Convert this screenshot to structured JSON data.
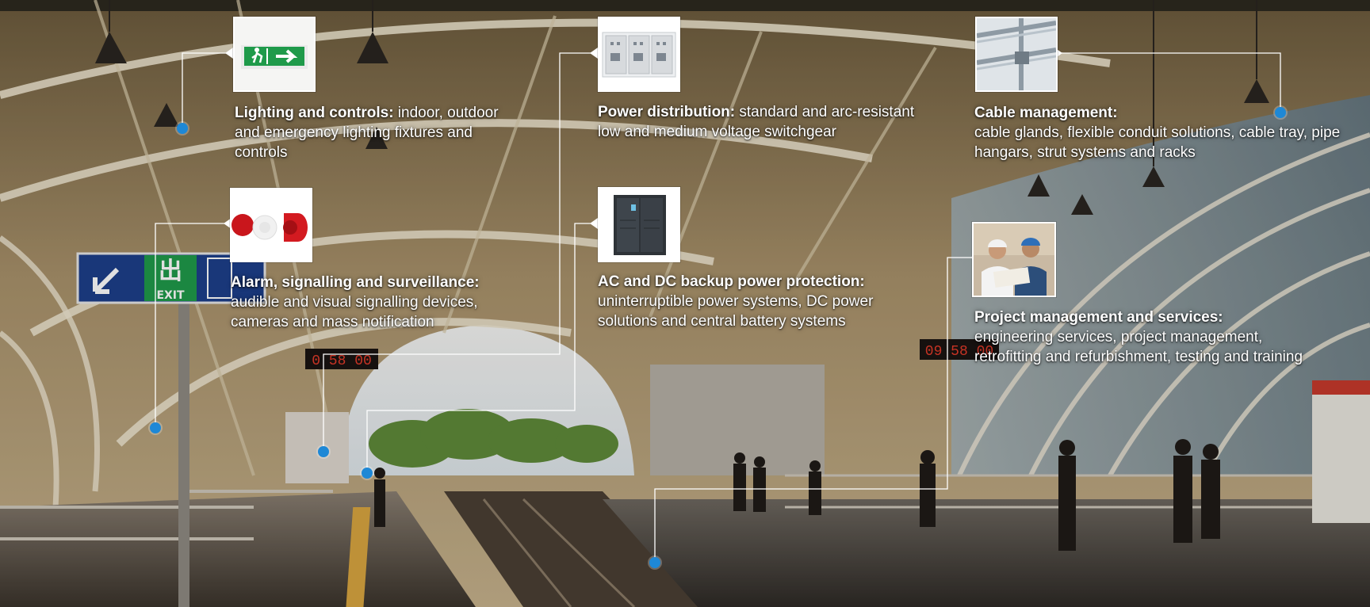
{
  "callouts": [
    {
      "title": "Lighting and controls:",
      "desc": " indoor, outdoor and emergency lighting fixtures and controls",
      "thumb_icon": "exit-sign-icon"
    },
    {
      "title": "Power distribution:",
      "desc": " standard and arc-resistant low and medium voltage switchgear",
      "thumb_icon": "switchgear-icon"
    },
    {
      "title": "Cable management:",
      "desc": "cable glands, flexible conduit solutions, cable tray, pipe hangars, strut systems and racks",
      "thumb_icon": "cable-tray-icon"
    },
    {
      "title": "Alarm, signalling and surveillance:",
      "desc": "audible and visual signalling devices, cameras and mass notification",
      "thumb_icon": "alarm-beacon-icon"
    },
    {
      "title": "AC and DC backup power protection:",
      "desc": "uninterruptible power systems, DC power solutions and central battery systems",
      "thumb_icon": "ups-cabinet-icon"
    },
    {
      "title": "Project management and services:",
      "desc": "engineering services, project management, retrofitting and refurbishment, testing and training",
      "thumb_icon": "engineers-icon"
    }
  ],
  "scene": {
    "exit_sign_text": "EXIT",
    "exit_sign_glyph": "出",
    "clock_left": "0 58 00",
    "clock_right": "09 58 00"
  },
  "colors": {
    "dot": "#1e88d6",
    "exit_green": "#1f9a4a",
    "sign_blue": "#1d3f8a",
    "clock_red": "#e23b2a"
  }
}
